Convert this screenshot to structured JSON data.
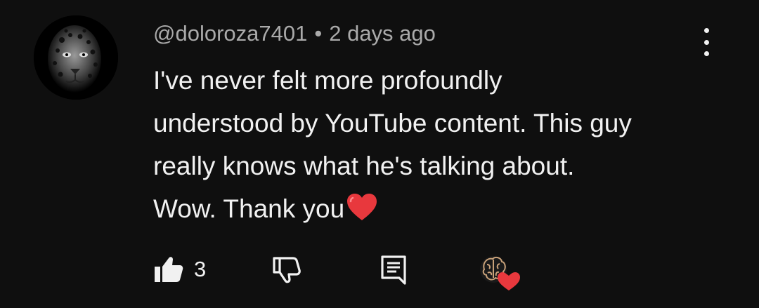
{
  "comment": {
    "author": "@doloroza7401",
    "separator": "•",
    "timestamp": "2 days ago",
    "text_lines": [
      "I've never felt more profoundly",
      "understood by YouTube content. This guy",
      "really knows what he's talking about.",
      "Wow. Thank you"
    ],
    "like_count": "3"
  },
  "icons": {
    "avatar": "leopard-avatar",
    "menu": "more-vertical-icon",
    "like": "thumbs-up-filled-icon",
    "dislike": "thumbs-down-outline-icon",
    "reply": "reply-comment-icon",
    "creator_heart": "creator-heart-brain-icon",
    "inline_emoji": "red-heart-emoji"
  },
  "colors": {
    "background": "#0f0f0f",
    "text": "#f1f1f1",
    "secondary_text": "#aaaaaa",
    "heart": "#e8383d"
  }
}
